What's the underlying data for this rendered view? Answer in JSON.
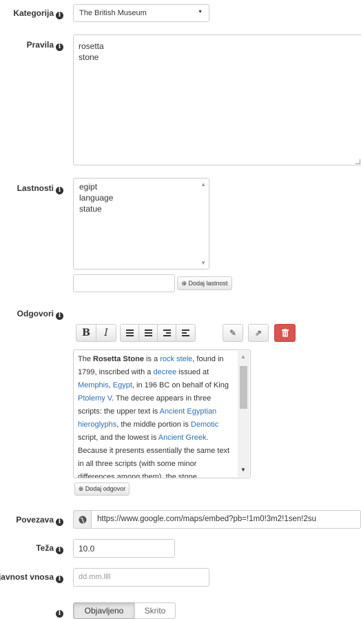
{
  "form": {
    "category": {
      "label": "Kategorija",
      "value": "The British Museum"
    },
    "rules": {
      "label": "Pravila",
      "lines": [
        "rosetta",
        "stone"
      ]
    },
    "properties": {
      "label": "Lastnosti",
      "items": [
        "egipt",
        "language",
        "statue"
      ],
      "new_placeholder": "",
      "add_button": "Dodaj lastnost"
    },
    "answers": {
      "label": "Odgovori",
      "toolbar": {
        "bold": "B",
        "italic": "I"
      },
      "text_segments": [
        {
          "t": "The "
        },
        {
          "t": "Rosetta Stone",
          "b": true
        },
        {
          "t": " is a "
        },
        {
          "t": "rock stele",
          "a": true
        },
        {
          "t": ", found in 1799, inscribed with a "
        },
        {
          "t": "decree",
          "a": true
        },
        {
          "t": " issued at "
        },
        {
          "t": "Memphis",
          "a": true
        },
        {
          "t": ", "
        },
        {
          "t": "Egypt",
          "a": true
        },
        {
          "t": ", in 196 BC on behalf of King "
        },
        {
          "t": "Ptolemy V",
          "a": true
        },
        {
          "t": ". The decree appears in three scripts: the upper text is "
        },
        {
          "t": "Ancient Egyptian hieroglyphs",
          "a": true
        },
        {
          "t": ", the middle portion is "
        },
        {
          "t": "Demotic",
          "a": true
        },
        {
          "t": " script, and the lowest is "
        },
        {
          "t": "Ancient Greek",
          "a": true
        },
        {
          "t": ". Because it presents essentially the same text in all three scripts (with some minor differences among them), the stone"
        }
      ],
      "add_button": "Dodaj odgovor"
    },
    "link": {
      "label": "Povezava",
      "value": "https://www.google.com/maps/embed?pb=!1m0!3m2!1sen!2su"
    },
    "weight": {
      "label": "Teža",
      "value": "10.0"
    },
    "validity": {
      "label": "Veljavnost vnosa",
      "placeholder": "dd.mm.llll"
    },
    "visibility": {
      "label": "",
      "published": "Objavljeno",
      "hidden": "Skrito"
    }
  },
  "colors": {
    "delete_button": "#d9534f",
    "link": "#2a6fb7",
    "active_toggle": "#e6e6e6"
  }
}
